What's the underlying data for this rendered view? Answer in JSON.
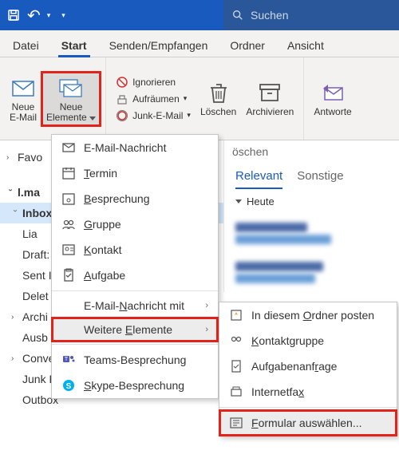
{
  "titlebar": {
    "search_placeholder": "Suchen"
  },
  "tabs": {
    "file": "Datei",
    "home": "Start",
    "sendrecv": "Senden/Empfangen",
    "folder": "Ordner",
    "view": "Ansicht"
  },
  "ribbon": {
    "new_email_l1": "Neue",
    "new_email_l2": "E-Mail",
    "new_items_l1": "Neue",
    "new_items_l2": "Elemente",
    "ignore": "Ignorieren",
    "cleanup": "Aufräumen",
    "junk": "Junk-E-Mail",
    "delete": "Löschen",
    "archive": "Archivieren",
    "reply": "Antworte"
  },
  "dropdown": {
    "email": "E-Mail-Nachricht",
    "appt": "Termin",
    "meeting": "Besprechung",
    "group": "Gruppe",
    "contact": "Kontakt",
    "task": "Aufgabe",
    "email_using": "E-Mail-Nachricht mit",
    "more": "Weitere Elemente",
    "teams": "Teams-Besprechung",
    "skype": "Skype-Besprechung"
  },
  "submenu": {
    "post": "In diesem Ordner posten",
    "contactgrp": "Kontaktgruppe",
    "taskreq": "Aufgabenanfrage",
    "ifax": "Internetfax",
    "form": "Formular auswählen..."
  },
  "folders": {
    "fav": "Favo",
    "acct": "l.ma",
    "inbox": "Inbox",
    "lia": "Lia",
    "drafts": "Draft:",
    "sent": "Sent I",
    "deleted": "Delet",
    "archive": "Archi",
    "ausb": "Ausb",
    "conv": "Conversation History",
    "junk": "Junk Email",
    "outbox": "Outbox"
  },
  "rightpane": {
    "header": "öschen",
    "relevant": "Relevant",
    "other": "Sonstige",
    "today": "Heute"
  }
}
